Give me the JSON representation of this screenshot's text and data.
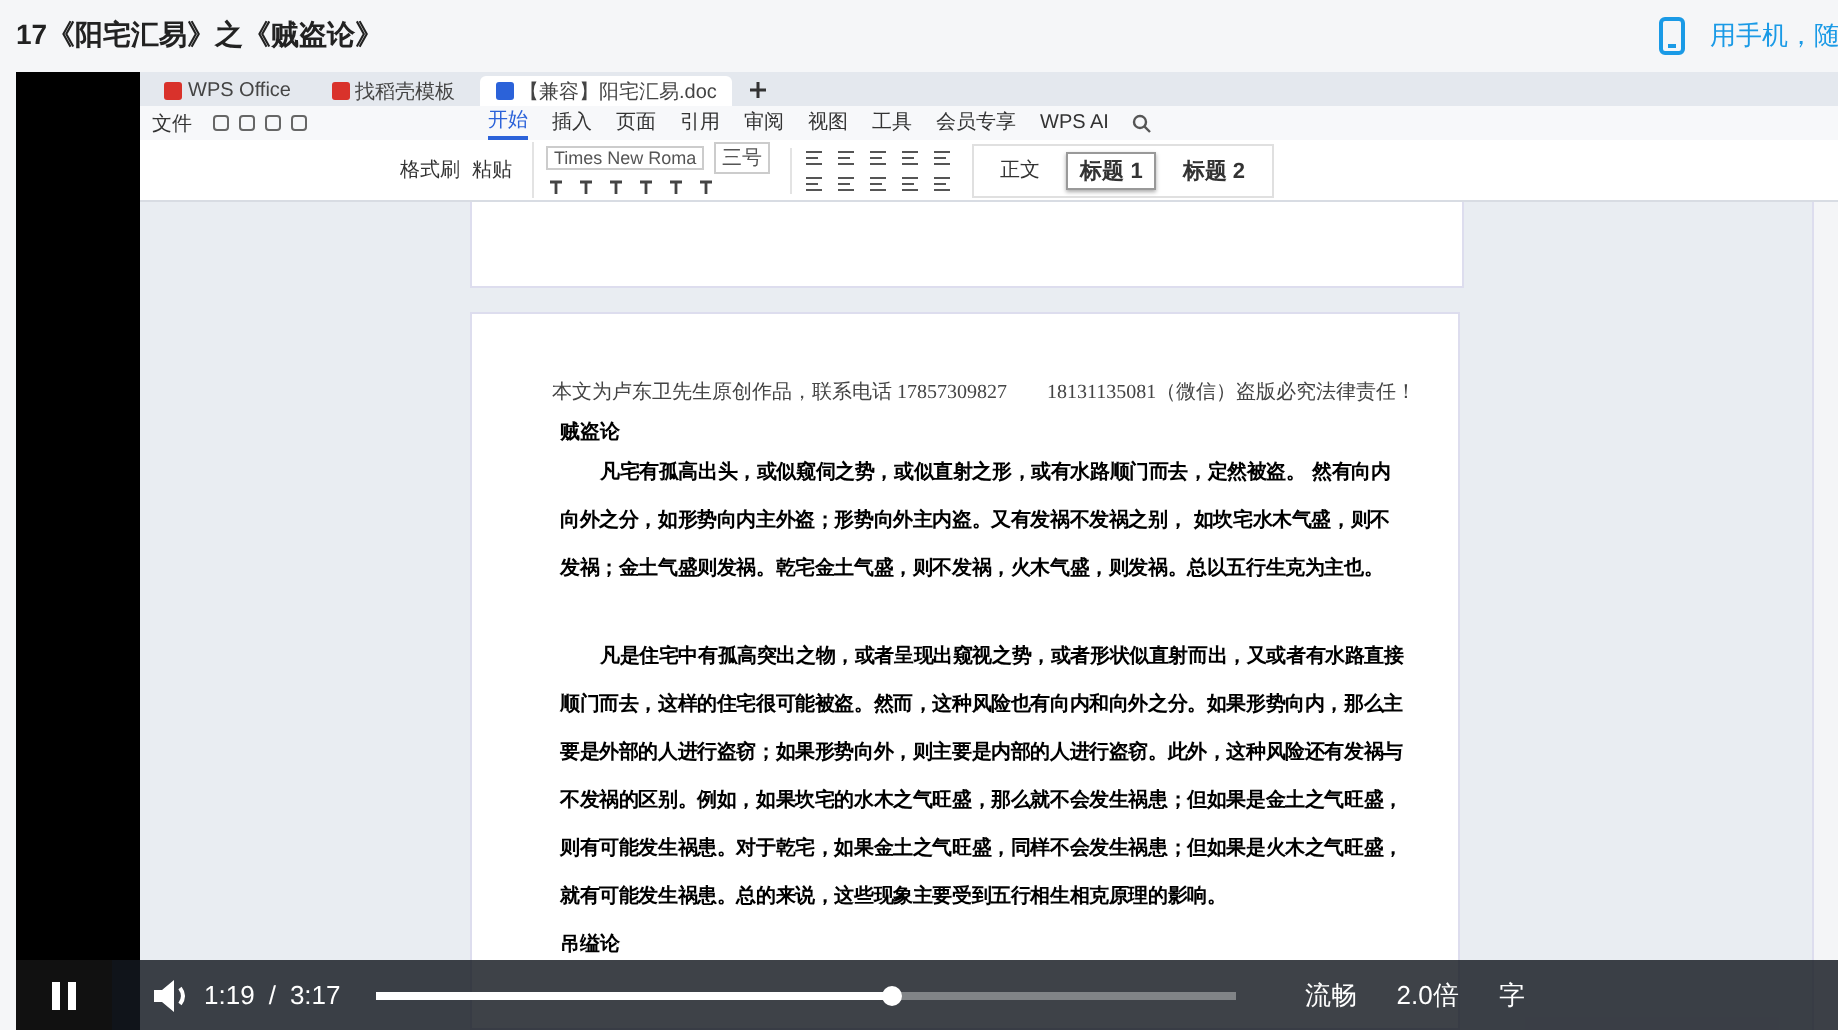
{
  "page_title": "17《阳宅汇易》之《贼盗论》",
  "mobile_link": "用手机，随",
  "wps": {
    "app_tabs": [
      {
        "label": "WPS Office",
        "selected": false
      },
      {
        "label": "找稻壳模板",
        "selected": false
      },
      {
        "label": "【兼容】阳宅汇易.doc",
        "selected": true
      }
    ],
    "file_menu": "文件",
    "ribbon_tabs": [
      {
        "label": "开始",
        "selected": true
      },
      {
        "label": "插入",
        "selected": false
      },
      {
        "label": "页面",
        "selected": false
      },
      {
        "label": "引用",
        "selected": false
      },
      {
        "label": "审阅",
        "selected": false
      },
      {
        "label": "视图",
        "selected": false
      },
      {
        "label": "工具",
        "selected": false
      },
      {
        "label": "会员专享",
        "selected": false
      },
      {
        "label": "WPS AI",
        "selected": false
      }
    ],
    "clipboard": [
      "格式刷",
      "粘贴"
    ],
    "font_name": "Times New Roma",
    "font_size": "三号",
    "styles": [
      {
        "label": "正文",
        "selected": false
      },
      {
        "label": "标题 1",
        "selected": true
      },
      {
        "label": "标题 2",
        "selected": false
      }
    ]
  },
  "document": {
    "header": "本文为卢东卫先生原创作品，联系电话 17857309827　　18131135081（微信）盗版必究法律责任！",
    "blocks": [
      {
        "kind": "heading",
        "text": "贼盗论"
      },
      {
        "kind": "paragraph",
        "text": "凡宅有孤高出头，或似窥伺之势，或似直射之形，或有水路顺门而去，定然被盗。 然有向内向外之分，如形势向内主外盗；形势向外主内盗。又有发祸不发祸之别， 如坎宅水木气盛，则不发祸；金土气盛则发祸。乾宅金土气盛，则不发祸，火木气盛，则发祸。总以五行生克为主也。"
      },
      {
        "kind": "paragraph",
        "text": "凡是住宅中有孤高突出之物，或者呈现出窥视之势，或者形状似直射而出，又或者有水路直接顺门而去，这样的住宅很可能被盗。然而，这种风险也有向内和向外之分。如果形势向内，那么主要是外部的人进行盗窃；如果形势向外，则主要是内部的人进行盗窃。此外，这种风险还有发祸与不发祸的区别。例如，如果坎宅的水木之气旺盛，那么就不会发生祸患；但如果是金土之气旺盛，则有可能发生祸患。对于乾宅，如果金土之气旺盛，同样不会发生祸患；但如果是火木之气旺盛，就有可能发生祸患。总的来说，这些现象主要受到五行相生相克原理的影响。"
      },
      {
        "kind": "heading",
        "text": "吊缢论"
      }
    ]
  },
  "player": {
    "playing": true,
    "current": "1:19",
    "separator": "/",
    "duration": "3:17",
    "level": 0.6,
    "quality": "流畅",
    "speed": "2.0倍",
    "subtitles": "字"
  }
}
